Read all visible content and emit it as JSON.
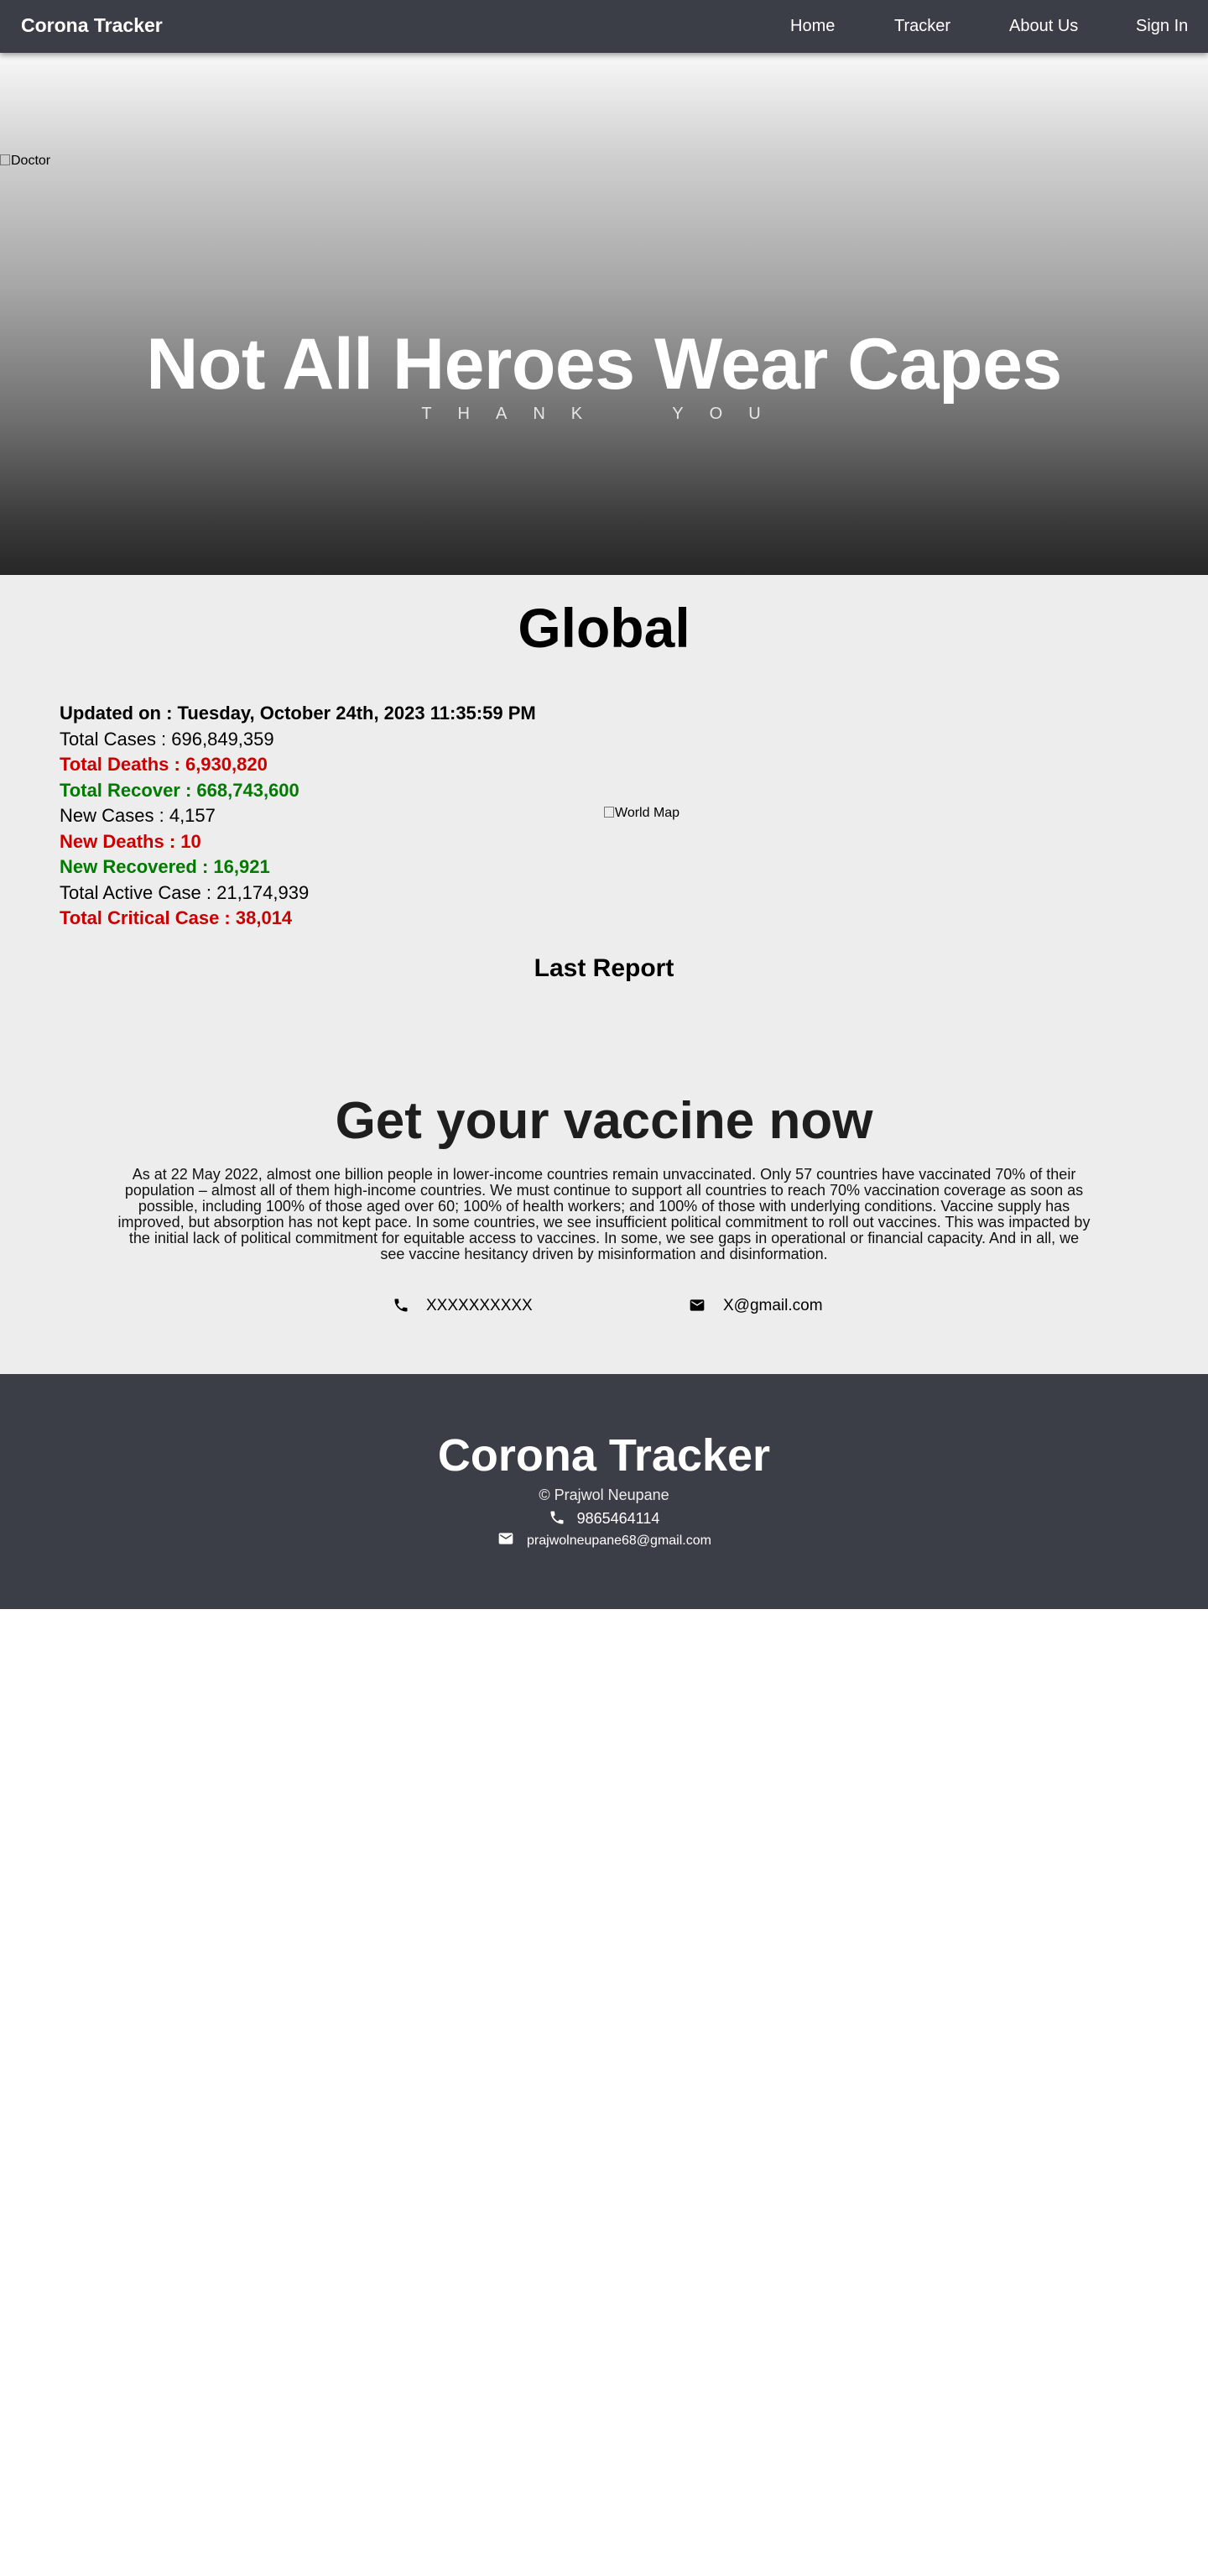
{
  "navbar": {
    "brand": "Corona Tracker",
    "links": [
      "Home",
      "Tracker",
      "About Us",
      "Sign In"
    ]
  },
  "hero": {
    "image_alt": "Doctor",
    "title": "Not All Heroes Wear Capes",
    "subtitle": "THANK YOU"
  },
  "global": {
    "title": "Global",
    "stats": [
      {
        "label": "Updated on : ",
        "value": "Tuesday, October 24th, 2023 11:35:59 PM",
        "color": "black"
      },
      {
        "label": "Total Cases : ",
        "value": "696,849,359",
        "color": "black"
      },
      {
        "label": "Total Deaths : ",
        "value": "6,930,820",
        "color": "red"
      },
      {
        "label": "Total Recover : ",
        "value": "668,743,600",
        "color": "green"
      },
      {
        "label": "New Cases : ",
        "value": "4,157",
        "color": "black"
      },
      {
        "label": "New Deaths : ",
        "value": "10",
        "color": "red"
      },
      {
        "label": "New Recovered : ",
        "value": "16,921",
        "color": "green"
      },
      {
        "label": "Total Active Case : ",
        "value": "21,174,939",
        "color": "black"
      },
      {
        "label": "Total Critical Case : ",
        "value": "38,014",
        "color": "red"
      }
    ],
    "map_alt": "World Map",
    "last_report": "Last Report"
  },
  "vaccine": {
    "title": "Get your vaccine now",
    "text": "As at 22 May 2022, almost one billion people in lower-income countries remain unvaccinated. Only 57 countries have vaccinated 70% of their population – almost all of them high-income countries. We must continue to support all countries to reach 70% vaccination coverage as soon as possible, including 100% of those aged over 60; 100% of health workers; and 100% of those with underlying conditions. Vaccine supply has improved, but absorption has not kept pace. In some countries, we see insufficient political commitment to roll out vaccines. This was impacted by the initial lack of political commitment for equitable access to vaccines. In some, we see gaps in operational or financial capacity. And in all, we see vaccine hesitancy driven by misinformation and disinformation.",
    "phone": "XXXXXXXXXX",
    "email": "X@gmail.com"
  },
  "footer": {
    "title": "Corona Tracker",
    "copyright": "© Prajwol Neupane",
    "phone": "9865464114",
    "email": "prajwolneupane68@gmail.com"
  },
  "colors": {
    "nav_bg": "#3b3e47",
    "section_bg": "#ededed",
    "red": "#cc0000",
    "green": "#007a00"
  }
}
